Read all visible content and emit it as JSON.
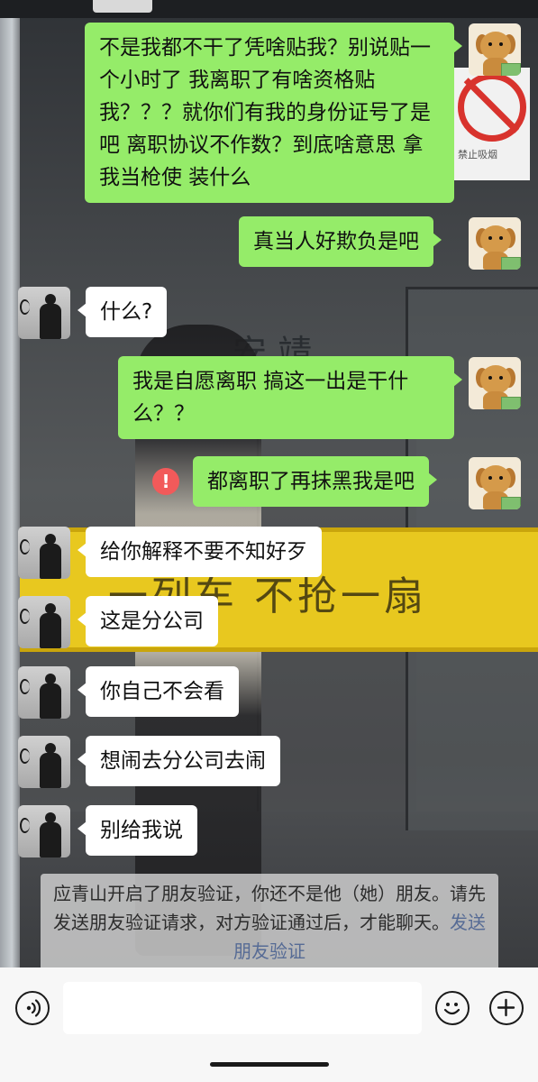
{
  "background": {
    "banner_text": "一列车 不抢一扇",
    "sign_text": "安 靖",
    "no_smoking_caption": "禁止吸烟"
  },
  "messages": [
    {
      "side": "me",
      "text": "不是我都不干了凭啥贴我？别说贴一个小时了 我离职了有啥资格贴我？？？就你们有我的身份证号了是吧 离职协议不作数？到底啥意思 拿我当枪使 装什么"
    },
    {
      "side": "me",
      "text": "真当人好欺负是吧"
    },
    {
      "side": "other",
      "text": "什么?"
    },
    {
      "side": "me",
      "text": "我是自愿离职 搞这一出是干什么？？"
    },
    {
      "side": "me",
      "text": "都离职了再抹黑我是吧",
      "failed": true,
      "fail_icon": "!"
    },
    {
      "side": "other",
      "text": "给你解释不要不知好歹"
    },
    {
      "side": "other",
      "text": "这是分公司"
    },
    {
      "side": "other",
      "text": "你自己不会看"
    },
    {
      "side": "other",
      "text": "想闹去分公司去闹"
    },
    {
      "side": "other",
      "text": "别给我说"
    }
  ],
  "system_notice": {
    "text": "应青山开启了朋友验证，你还不是他（她）朋友。请先发送朋友验证请求，对方验证通过后，才能聊天。",
    "link": "发送朋友验证"
  },
  "input_bar": {
    "value": "",
    "voice_icon": "voice-icon",
    "emoji_icon": "emoji-icon",
    "plus_icon": "plus-icon"
  }
}
